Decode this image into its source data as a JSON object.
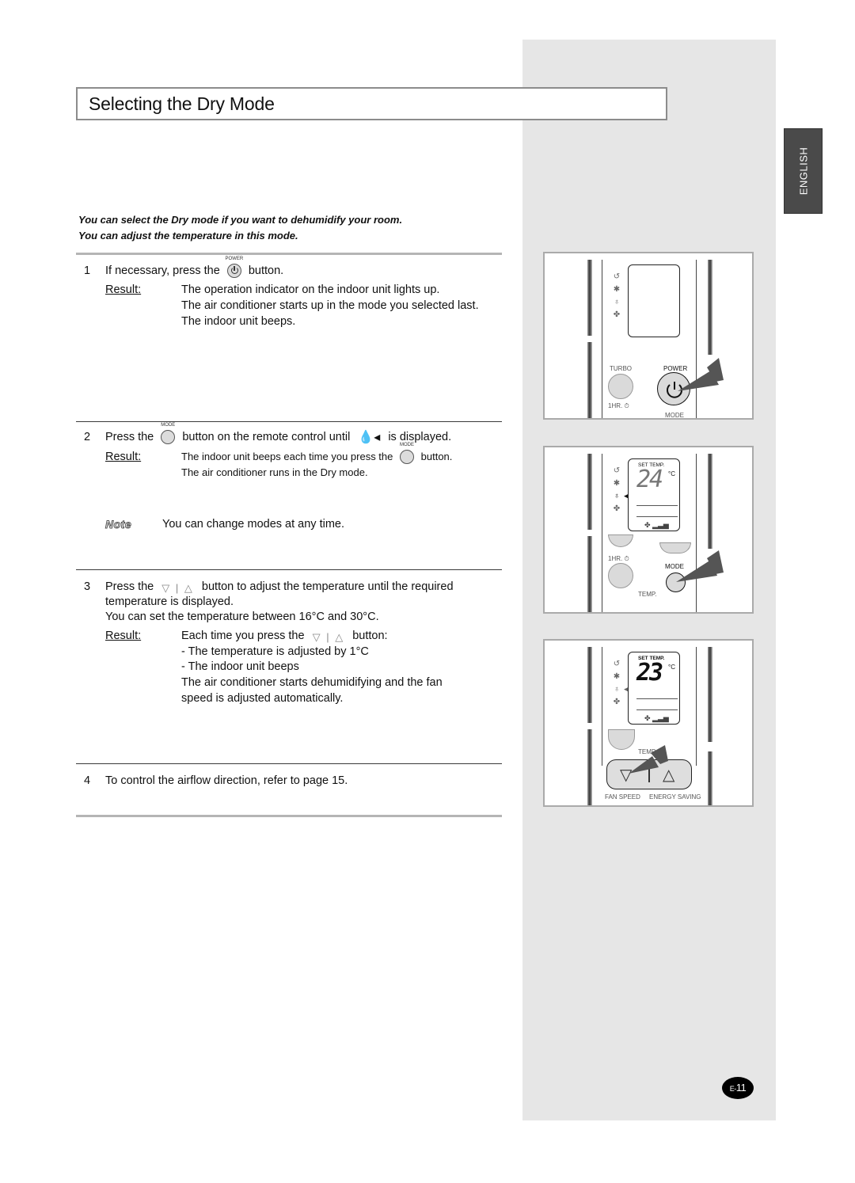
{
  "page": {
    "title": "Selecting the Dry Mode",
    "language_tab": "ENGLISH",
    "page_number_prefix": "E-",
    "page_number": "11"
  },
  "intro": {
    "line1": "You can select the Dry mode if you want to dehumidify your room.",
    "line2": "You can adjust the temperature in this mode."
  },
  "steps": [
    {
      "number": "1",
      "text_before": "If necessary, press the",
      "button_caption": "POWER",
      "text_after": "button.",
      "result_label": "Result:",
      "result_lines": [
        "The operation indicator on the indoor unit lights up.",
        "The air conditioner starts up in the mode you selected last.",
        "The indoor unit beeps."
      ]
    },
    {
      "number": "2",
      "text_before": "Press the",
      "button_caption": "MODE",
      "text_middle": "button on the remote control until",
      "text_after": "is displayed.",
      "result_label": "Result:",
      "result_line1_before": "The indoor unit beeps each time you press the",
      "result_line1_after": "button.",
      "result_line2": "The air conditioner runs in the Dry mode.",
      "note_label": "Note",
      "note_text": "You can change modes at any time."
    },
    {
      "number": "3",
      "text_before": "Press the",
      "text_after": "button to adjust the temperature until the required",
      "line2": "temperature is displayed.",
      "line3": "You can set the temperature between 16°C and 30°C.",
      "result_label": "Result:",
      "result_line1_before": "Each time you press the",
      "result_line1_after": "button:",
      "result_lines": [
        "- The temperature is adjusted by 1°C",
        "- The indoor unit beeps",
        "The air conditioner starts dehumidifying and the fan",
        "speed is adjusted automatically."
      ]
    },
    {
      "number": "4",
      "text": "To control the airflow direction, refer to page 15."
    }
  ],
  "remote_panels": [
    {
      "labels": {
        "turbo": "TURBO",
        "power": "POWER",
        "timer": "1HR. ⏱",
        "mode": "MODE"
      },
      "display": ""
    },
    {
      "labels": {
        "set_temp": "SET TEMP.",
        "timer": "1HR. ⏱",
        "mode": "MODE",
        "temp": "TEMP."
      },
      "display_temp": "24",
      "unit": "°C"
    },
    {
      "labels": {
        "set_temp": "SET TEMP.",
        "temp": "TEMP.",
        "fan_speed": "FAN SPEED",
        "energy_saving": "ENERGY SAVING"
      },
      "display_temp": "23",
      "unit": "°C"
    }
  ],
  "icons": {
    "triangle_pair": "▽ | △",
    "dry_indicator": "♁◂",
    "mode_icons": [
      "auto-icon",
      "cool-icon",
      "dry-icon",
      "fan-icon"
    ]
  }
}
